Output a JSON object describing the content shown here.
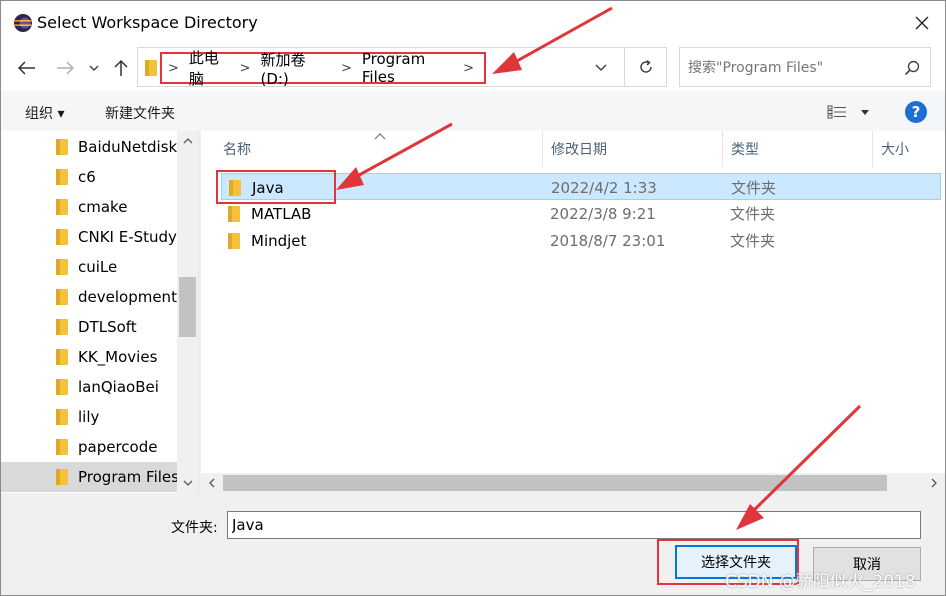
{
  "window": {
    "title": "Select Workspace Directory"
  },
  "nav": {
    "crumbs": [
      "此电脑",
      "新加卷 (D:)",
      "Program Files"
    ],
    "search_placeholder": "搜索\"Program Files\""
  },
  "toolbar": {
    "organize": "组织 ▾",
    "new_folder": "新建文件夹",
    "help": "?"
  },
  "tree": {
    "items": [
      "BaiduNetdiskI",
      "c6",
      "cmake",
      "CNKI E-Study",
      "cuiLe",
      "development",
      "DTLSoft",
      "KK_Movies",
      "lanQiaoBei",
      "lily",
      "papercode",
      "Program Files"
    ],
    "selected_index": 11
  },
  "columns": {
    "name": "名称",
    "date": "修改日期",
    "type": "类型",
    "size": "大小"
  },
  "files": [
    {
      "name": "Java",
      "date": "2022/4/2 1:33",
      "type": "文件夹"
    },
    {
      "name": "MATLAB",
      "date": "2022/3/8 9:21",
      "type": "文件夹"
    },
    {
      "name": "Mindjet",
      "date": "2018/8/7 23:01",
      "type": "文件夹"
    }
  ],
  "footer": {
    "folder_label": "文件夹:",
    "folder_value": "Java",
    "ok_label": "选择文件夹",
    "cancel_label": "取消"
  },
  "watermark": "CSDN @骄阳似火_2018",
  "colors": {
    "annotation_red": "#e0353b",
    "selection_blue": "#cce8ff",
    "folder_yellow": "#f3c13a"
  }
}
